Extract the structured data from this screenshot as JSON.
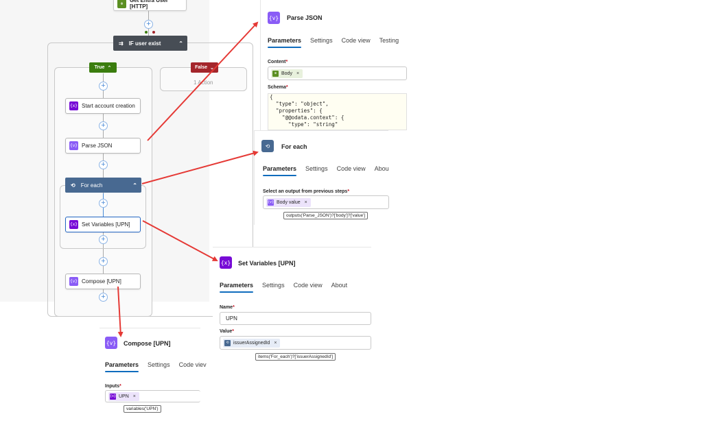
{
  "flow": {
    "top_action": "Get Entra User [HTTP]",
    "condition": "IF user exist",
    "true_label": "True",
    "false_label": "False",
    "false_summary": "1 Action",
    "actions": {
      "start_account": "Start account creation",
      "parse_json": "Parse JSON",
      "for_each": "For each",
      "set_variables": "Set Variables [UPN]",
      "compose": "Compose [UPN]"
    }
  },
  "parse_json_panel": {
    "title": "Parse JSON",
    "tabs": [
      "Parameters",
      "Settings",
      "Code view",
      "Testing"
    ],
    "content_label": "Content",
    "content_token": "Body",
    "schema_label": "Schema",
    "schema_lines": [
      "{",
      "  \"type\": \"object\",",
      "  \"properties\": {",
      "    \"@@odata.context\": {",
      "      \"type\": \"string\""
    ]
  },
  "for_each_panel": {
    "title": "For each",
    "tabs": [
      "Parameters",
      "Settings",
      "Code view",
      "Abou"
    ],
    "output_label": "Select an output from previous steps",
    "output_token": "Body value",
    "expression": "outputs('Parse_JSON')?['body']?['value']"
  },
  "set_variables_panel": {
    "title": "Set Variables [UPN]",
    "tabs": [
      "Parameters",
      "Settings",
      "Code view",
      "About"
    ],
    "name_label": "Name",
    "name_value": "UPN",
    "value_label": "Value",
    "value_token": "issuerAssignedId",
    "expression": "items('For_each')?['issuerAssignedId']"
  },
  "compose_panel": {
    "title": "Compose [UPN]",
    "tabs": [
      "Parameters",
      "Settings",
      "Code viev"
    ],
    "inputs_label": "Inputs",
    "inputs_token": "UPN",
    "expression": "variables('UPN')"
  },
  "icons": {
    "variable": "{x}",
    "json": "{v}",
    "loop": "⟲",
    "http": "⊕",
    "remove": "×",
    "chevron_up": "^",
    "chevron_down": "v",
    "add": "+"
  },
  "colors": {
    "condition_header": "#474d55",
    "true_branch": "#3b7d0e",
    "false_branch": "#a4262c",
    "for_each_header": "#486991",
    "variable_icon": "#770bd6",
    "json_icon": "#8a5cf6",
    "http_icon": "#5b8f22",
    "tab_underline": "#0f6cbd",
    "arrow": "#e53935"
  }
}
